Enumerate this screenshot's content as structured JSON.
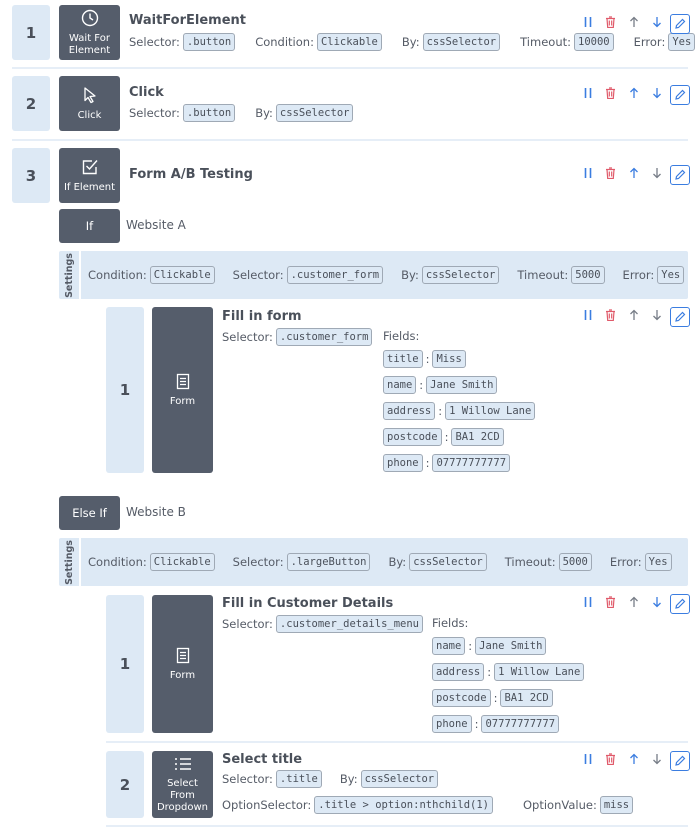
{
  "colors": {
    "accent": "#3b7de0",
    "danger": "#e05a6a",
    "tile": "#555d6b",
    "chip_bg": "#dde9f5",
    "muted": "#777d87"
  },
  "steps": [
    {
      "number": "1",
      "type": "Wait For Element",
      "icon": "clock-icon",
      "title": "WaitForElement",
      "params": [
        {
          "label": "Selector:",
          "value": ".button"
        },
        {
          "label": "Condition:",
          "value": "Clickable"
        },
        {
          "label": "By:",
          "value": "cssSelector"
        },
        {
          "label": "Timeout:",
          "value": "10000"
        },
        {
          "label": "Error:",
          "value": "Yes"
        }
      ],
      "can_move_up": false,
      "can_move_down": true
    },
    {
      "number": "2",
      "type": "Click",
      "icon": "cursor-icon",
      "title": "Click",
      "params": [
        {
          "label": "Selector:",
          "value": ".button"
        },
        {
          "label": "By:",
          "value": "cssSelector"
        }
      ],
      "can_move_up": true,
      "can_move_down": true
    },
    {
      "number": "3",
      "type": "If Element",
      "icon": "checkbox-icon",
      "title": "Form A/B Testing",
      "can_move_up": true,
      "can_move_down": false,
      "branches": [
        {
          "kind": "If",
          "label": "Website A",
          "settings_label": "Settings",
          "settings": [
            {
              "label": "Condition:",
              "value": "Clickable"
            },
            {
              "label": "Selector:",
              "value": ".customer_form"
            },
            {
              "label": "By:",
              "value": "cssSelector"
            },
            {
              "label": "Timeout:",
              "value": "5000"
            },
            {
              "label": "Error:",
              "value": "Yes"
            }
          ],
          "steps": [
            {
              "number": "1",
              "type": "Form",
              "icon": "form-icon",
              "title": "Fill in form",
              "params": [
                {
                  "label": "Selector:",
                  "value": ".customer_form"
                }
              ],
              "fields_label": "Fields:",
              "fields": [
                {
                  "key": "title",
                  "value": "Miss"
                },
                {
                  "key": "name",
                  "value": "Jane Smith"
                },
                {
                  "key": "address",
                  "value": "1 Willow Lane"
                },
                {
                  "key": "postcode",
                  "value": "BA1 2CD"
                },
                {
                  "key": "phone",
                  "value": "07777777777"
                }
              ],
              "can_move_up": false,
              "can_move_down": false
            }
          ]
        },
        {
          "kind": "Else If",
          "label": "Website B",
          "settings_label": "Settings",
          "settings": [
            {
              "label": "Condition:",
              "value": "Clickable"
            },
            {
              "label": "Selector:",
              "value": ".largeButton"
            },
            {
              "label": "By:",
              "value": "cssSelector"
            },
            {
              "label": "Timeout:",
              "value": "5000"
            },
            {
              "label": "Error:",
              "value": "Yes"
            }
          ],
          "steps": [
            {
              "number": "1",
              "type": "Form",
              "icon": "form-icon",
              "title": "Fill in Customer Details",
              "params": [
                {
                  "label": "Selector:",
                  "value": ".customer_details_menu"
                }
              ],
              "fields_label": "Fields:",
              "fields": [
                {
                  "key": "name",
                  "value": "Jane Smith"
                },
                {
                  "key": "address",
                  "value": "1 Willow Lane"
                },
                {
                  "key": "postcode",
                  "value": "BA1 2CD"
                },
                {
                  "key": "phone",
                  "value": "07777777777"
                }
              ],
              "can_move_up": false,
              "can_move_down": true
            },
            {
              "number": "2",
              "type": "Select From Dropdown",
              "icon": "list-icon",
              "title": "Select title",
              "params": [
                {
                  "label": "Selector:",
                  "value": ".title"
                },
                {
                  "label": "By:",
                  "value": "cssSelector"
                }
              ],
              "params2": [
                {
                  "label": "OptionSelector:",
                  "value": ".title > option:nthchild(1)"
                },
                {
                  "label": "OptionValue:",
                  "value": "miss"
                }
              ],
              "can_move_up": true,
              "can_move_down": false
            }
          ]
        }
      ]
    }
  ]
}
